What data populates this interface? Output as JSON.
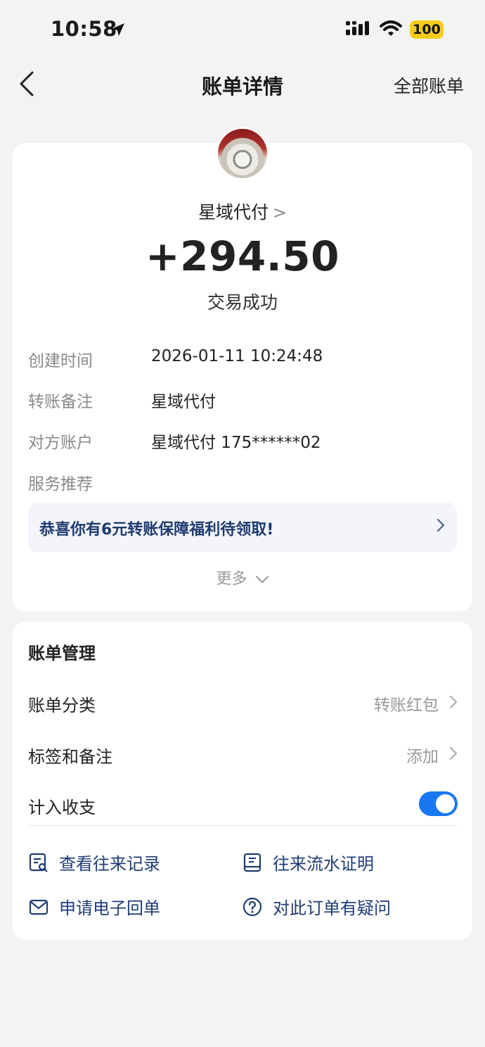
{
  "status_bar": {
    "time": "10:58",
    "battery": "100"
  },
  "nav": {
    "title": "账单详情",
    "right_link": "全部账单"
  },
  "transaction": {
    "merchant": "星域代付",
    "merchant_chevron": ">",
    "amount": "+294.50",
    "status": "交易成功",
    "details": [
      {
        "label": "创建时间",
        "value": "2026-01-11 10:24:48"
      },
      {
        "label": "转账备注",
        "value": "星域代付"
      },
      {
        "label": "对方账户",
        "value": "星域代付 175******02"
      },
      {
        "label": "服务推荐",
        "value": ""
      }
    ],
    "promo": "恭喜你有6元转账保障福利待领取!",
    "promo_chevron": ">",
    "more": "更多"
  },
  "management": {
    "title": "账单管理",
    "rows": [
      {
        "label": "账单分类",
        "value": "转账红包"
      },
      {
        "label": "标签和备注",
        "value": "添加"
      },
      {
        "label": "计入收支",
        "value": ""
      }
    ],
    "toggle_on": true,
    "links": [
      {
        "label": "查看往来记录",
        "icon": "record-search-icon"
      },
      {
        "label": "往来流水证明",
        "icon": "statement-proof-icon"
      },
      {
        "label": "申请电子回单",
        "icon": "mail-icon"
      },
      {
        "label": "对此订单有疑问",
        "icon": "question-circle-icon"
      }
    ]
  },
  "colors": {
    "accent": "#1877f2",
    "link": "#1f3c74",
    "promo_bg": "#f3f5fa",
    "battery": "#f5cc18"
  }
}
